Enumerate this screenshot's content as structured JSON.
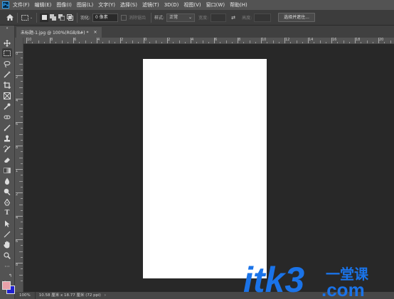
{
  "app": {
    "logo_text": "Ps"
  },
  "menu": [
    "文件(F)",
    "编辑(E)",
    "图像(I)",
    "图层(L)",
    "文字(Y)",
    "选择(S)",
    "滤镜(T)",
    "3D(D)",
    "视图(V)",
    "窗口(W)",
    "帮助(H)"
  ],
  "options": {
    "feather_label": "羽化:",
    "feather_value": "0 像素",
    "antialias_label": "消除锯齿",
    "style_label": "样式:",
    "style_value": "正常",
    "width_label": "宽度:",
    "height_label": "高度:",
    "select_mask_button": "选择并遮住..."
  },
  "tab": {
    "title": "未标题-1.jpg @ 100%(RGB/8#) *",
    "close": "×"
  },
  "ruler_top_ticks": [
    "10",
    "8",
    "6",
    "4",
    "2",
    "0",
    "2",
    "4",
    "6",
    "8",
    "10",
    "12",
    "14",
    "16",
    "18",
    "20"
  ],
  "ruler_left_ticks": [
    "0",
    "2",
    "4",
    "6",
    "8",
    "1",
    "2",
    "4",
    "6",
    "8"
  ],
  "status": {
    "zoom": "100%",
    "info": "10.58 厘米 x 18.77 厘米 (72 ppi)",
    "arrow": "›"
  },
  "watermark": {
    "brand": "itk3",
    "cn": "一堂课",
    "domain": ".com",
    "color_blue": "#1a73e8"
  },
  "colors": {
    "foreground": "#e8a0a8",
    "background": "#2020d0"
  }
}
